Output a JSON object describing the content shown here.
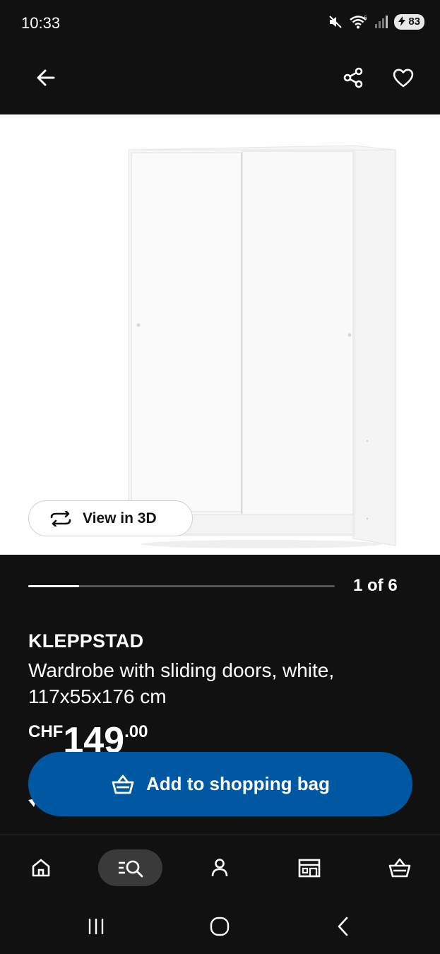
{
  "status": {
    "time": "10:33",
    "battery": "83",
    "wifi_badge": "6"
  },
  "app_bar": {
    "back_icon": "arrow-left-icon",
    "share_icon": "share-icon",
    "favorite_icon": "heart-icon"
  },
  "gallery": {
    "view_3d_label": "View in 3D",
    "page_indicator": "1 of 6",
    "current_page": 1,
    "total_pages": 6
  },
  "product": {
    "name": "KLEPPSTAD",
    "description": "Wardrobe with sliding doors, white, 117x55x176 cm",
    "price_currency": "CHF",
    "price_integer": "149",
    "price_decimal": ".00"
  },
  "actions": {
    "add_to_bag_label": "Add to shopping bag"
  },
  "bottom_nav": {
    "items": [
      {
        "icon": "home-icon",
        "active": false
      },
      {
        "icon": "search-icon",
        "active": true
      },
      {
        "icon": "profile-icon",
        "active": false
      },
      {
        "icon": "store-icon",
        "active": false
      },
      {
        "icon": "basket-icon",
        "active": false
      }
    ]
  },
  "colors": {
    "background": "#111111",
    "primary_button": "#0058a3",
    "text": "#ffffff"
  }
}
